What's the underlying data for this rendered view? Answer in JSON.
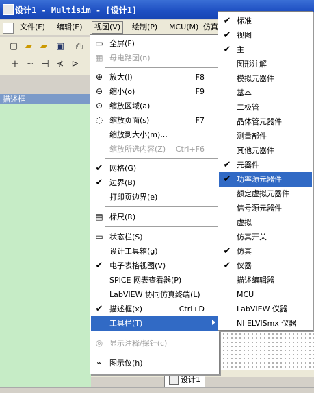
{
  "window": {
    "title": "设计1 - Multisim - [设计1]"
  },
  "menubar": {
    "items": [
      {
        "label": "文件(F)"
      },
      {
        "label": "编辑(E)"
      },
      {
        "label": "视图(V)"
      },
      {
        "label": "绘制(P)"
      },
      {
        "label": "MCU(M)"
      },
      {
        "label": "仿真"
      }
    ]
  },
  "panel": {
    "title": "描述框"
  },
  "tabs": [
    {
      "label": "设计1"
    }
  ],
  "view_menu": {
    "items": [
      {
        "label": "全屏(F)",
        "shortcut": "",
        "icon": "fullscreen-icon"
      },
      {
        "label": "母电路图(n)",
        "shortcut": "",
        "icon": "parent-sheet-icon",
        "disabled": true
      },
      {
        "label": "放大(i)",
        "shortcut": "F8",
        "icon": "zoom-in-icon"
      },
      {
        "label": "缩小(o)",
        "shortcut": "F9",
        "icon": "zoom-out-icon"
      },
      {
        "label": "缩放区域(a)",
        "shortcut": "",
        "icon": "zoom-area-icon"
      },
      {
        "label": "缩放页面(s)",
        "shortcut": "F7",
        "icon": "zoom-page-icon"
      },
      {
        "label": "缩放到大小(m)...",
        "shortcut": ""
      },
      {
        "label": "缩放所选内容(Z)",
        "shortcut": "Ctrl+F6",
        "disabled": true
      },
      {
        "label": "网格(G)",
        "shortcut": "",
        "checked": true
      },
      {
        "label": "边界(B)",
        "shortcut": "",
        "checked": true
      },
      {
        "label": "打印页边界(e)",
        "shortcut": ""
      },
      {
        "label": "标尺(R)",
        "shortcut": "",
        "icon": "ruler-icon"
      },
      {
        "label": "状态栏(S)",
        "shortcut": "",
        "icon": "statusbar-icon"
      },
      {
        "label": "设计工具箱(g)",
        "shortcut": ""
      },
      {
        "label": "电子表格视图(V)",
        "shortcut": "",
        "checked": true
      },
      {
        "label": "SPICE 网表查看器(P)",
        "shortcut": ""
      },
      {
        "label": "LabVIEW 协同仿真终端(L)",
        "shortcut": ""
      },
      {
        "label": "描述框(x)",
        "shortcut": "Ctrl+D",
        "checked": true
      },
      {
        "label": "工具栏(T)",
        "shortcut": "",
        "highlighted": true,
        "submenu": true
      },
      {
        "label": "显示注释/探针(c)",
        "shortcut": "",
        "icon": "annotation-icon",
        "disabled": true
      },
      {
        "label": "图示仪(h)",
        "shortcut": "",
        "icon": "grapher-icon"
      }
    ]
  },
  "toolbar_menu": {
    "items": [
      {
        "label": "标准",
        "checked": true
      },
      {
        "label": "视图",
        "checked": true
      },
      {
        "label": "主",
        "checked": true
      },
      {
        "label": "图形注解",
        "checked": false
      },
      {
        "label": "模拟元器件",
        "checked": false
      },
      {
        "label": "基本",
        "checked": false
      },
      {
        "label": "二极管",
        "checked": false
      },
      {
        "label": "晶体管元器件",
        "checked": false
      },
      {
        "label": "测量部件",
        "checked": false
      },
      {
        "label": "其他元器件",
        "checked": false
      },
      {
        "label": "元器件",
        "checked": true
      },
      {
        "label": "功率源元器件",
        "checked": true,
        "highlighted": true
      },
      {
        "label": "额定虚拟元器件",
        "checked": false
      },
      {
        "label": "信号源元器件",
        "checked": false
      },
      {
        "label": "虚拟",
        "checked": false
      },
      {
        "label": "仿真开关",
        "checked": false
      },
      {
        "label": "仿真",
        "checked": true
      },
      {
        "label": "仪器",
        "checked": true
      },
      {
        "label": "描述编辑器",
        "checked": false
      },
      {
        "label": "MCU",
        "checked": false
      },
      {
        "label": "LabVIEW 仪器",
        "checked": false
      },
      {
        "label": "NI ELVISmx 仪器",
        "checked": false
      }
    ]
  },
  "colors": {
    "highlight": "#316ac5",
    "title_bar": "#1e4fc2",
    "panel_body": "#c6ecc6"
  }
}
